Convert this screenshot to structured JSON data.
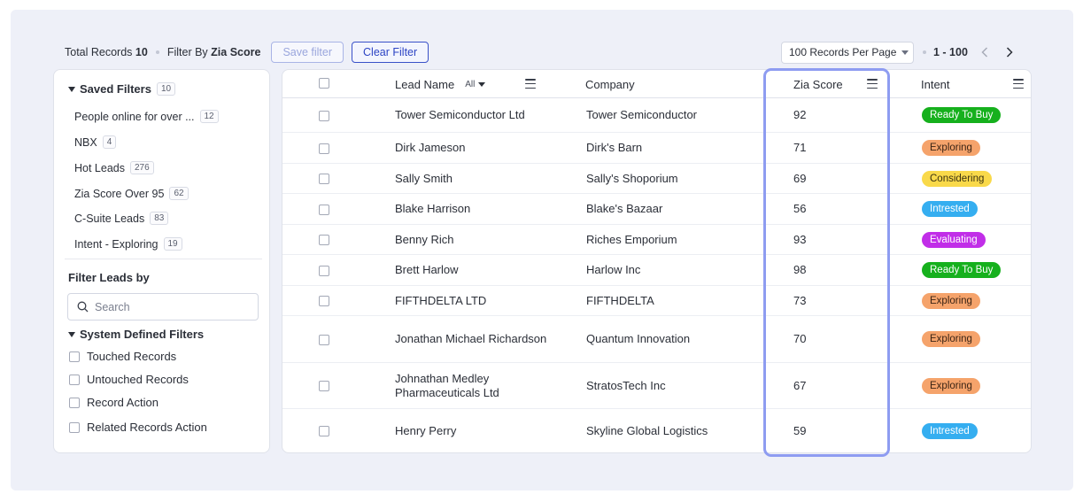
{
  "toolbar": {
    "total_label": "Total Records",
    "total_value": "10",
    "filter_by_label": "Filter By",
    "filter_by_value": "Zia Score",
    "save_filter": "Save filter",
    "clear_filter": "Clear Filter"
  },
  "pager": {
    "per_page": "100 Records Per Page",
    "range": "1 - 100"
  },
  "sidebar": {
    "saved_filters": {
      "title": "Saved Filters",
      "count": "10",
      "items": [
        {
          "label": "People online for over ...",
          "count": "12"
        },
        {
          "label": "NBX",
          "count": "4"
        },
        {
          "label": "Hot Leads",
          "count": "276"
        },
        {
          "label": "Zia Score Over 95",
          "count": "62"
        },
        {
          "label": "C-Suite Leads",
          "count": "83"
        },
        {
          "label": "Intent - Exploring",
          "count": "19"
        }
      ]
    },
    "filter_leads_by": "Filter Leads by",
    "search_placeholder": "Search",
    "system_filters": {
      "title": "System Defined Filters",
      "items": [
        "Touched Records",
        "Untouched Records",
        "Record Action",
        "Related Records Action"
      ]
    }
  },
  "table": {
    "columns": {
      "lead_name": "Lead Name",
      "lead_name_filter": "All",
      "company": "Company",
      "zia_score": "Zia Score",
      "intent": "Intent"
    },
    "rows": [
      {
        "lead": "Tower Semiconductor Ltd",
        "company": "Tower Semiconductor",
        "score": "92",
        "intent": "Ready To Buy"
      },
      {
        "lead": "Dirk Jameson",
        "company": "Dirk's Barn",
        "score": "71",
        "intent": "Exploring"
      },
      {
        "lead": "Sally Smith",
        "company": "Sally's Shoporium",
        "score": "69",
        "intent": "Considering"
      },
      {
        "lead": "Blake Harrison",
        "company": "Blake's Bazaar",
        "score": "56",
        "intent": "Intrested"
      },
      {
        "lead": "Benny Rich",
        "company": "Riches Emporium",
        "score": "93",
        "intent": "Evaluating"
      },
      {
        "lead": "Brett Harlow",
        "company": "Harlow Inc",
        "score": "98",
        "intent": "Ready To Buy"
      },
      {
        "lead": "FIFTHDELTA LTD",
        "company": "FIFTHDELTA",
        "score": "73",
        "intent": "Exploring"
      },
      {
        "lead": "Jonathan Michael Richardson",
        "company": "Quantum Innovation",
        "score": "70",
        "intent": "Exploring"
      },
      {
        "lead": "Johnathan Medley Pharmaceuticals Ltd",
        "company": "StratosTech Inc",
        "score": "67",
        "intent": "Exploring"
      },
      {
        "lead": "Henry Perry",
        "company": "Skyline Global Logistics",
        "score": "59",
        "intent": "Intrested"
      }
    ]
  },
  "intent_colors": {
    "Ready To Buy": {
      "bg": "#16b01d",
      "fg": "#ffffff"
    },
    "Exploring": {
      "bg": "#f5a36b",
      "fg": "#3b2415"
    },
    "Considering": {
      "bg": "#f9d94a",
      "fg": "#3b3210"
    },
    "Intrested": {
      "bg": "#35aef0",
      "fg": "#ffffff"
    },
    "Evaluating": {
      "bg": "#c12ee8",
      "fg": "#ffffff"
    }
  },
  "highlight_color": "#8e9cf1",
  "accent_color": "#2c44c4"
}
